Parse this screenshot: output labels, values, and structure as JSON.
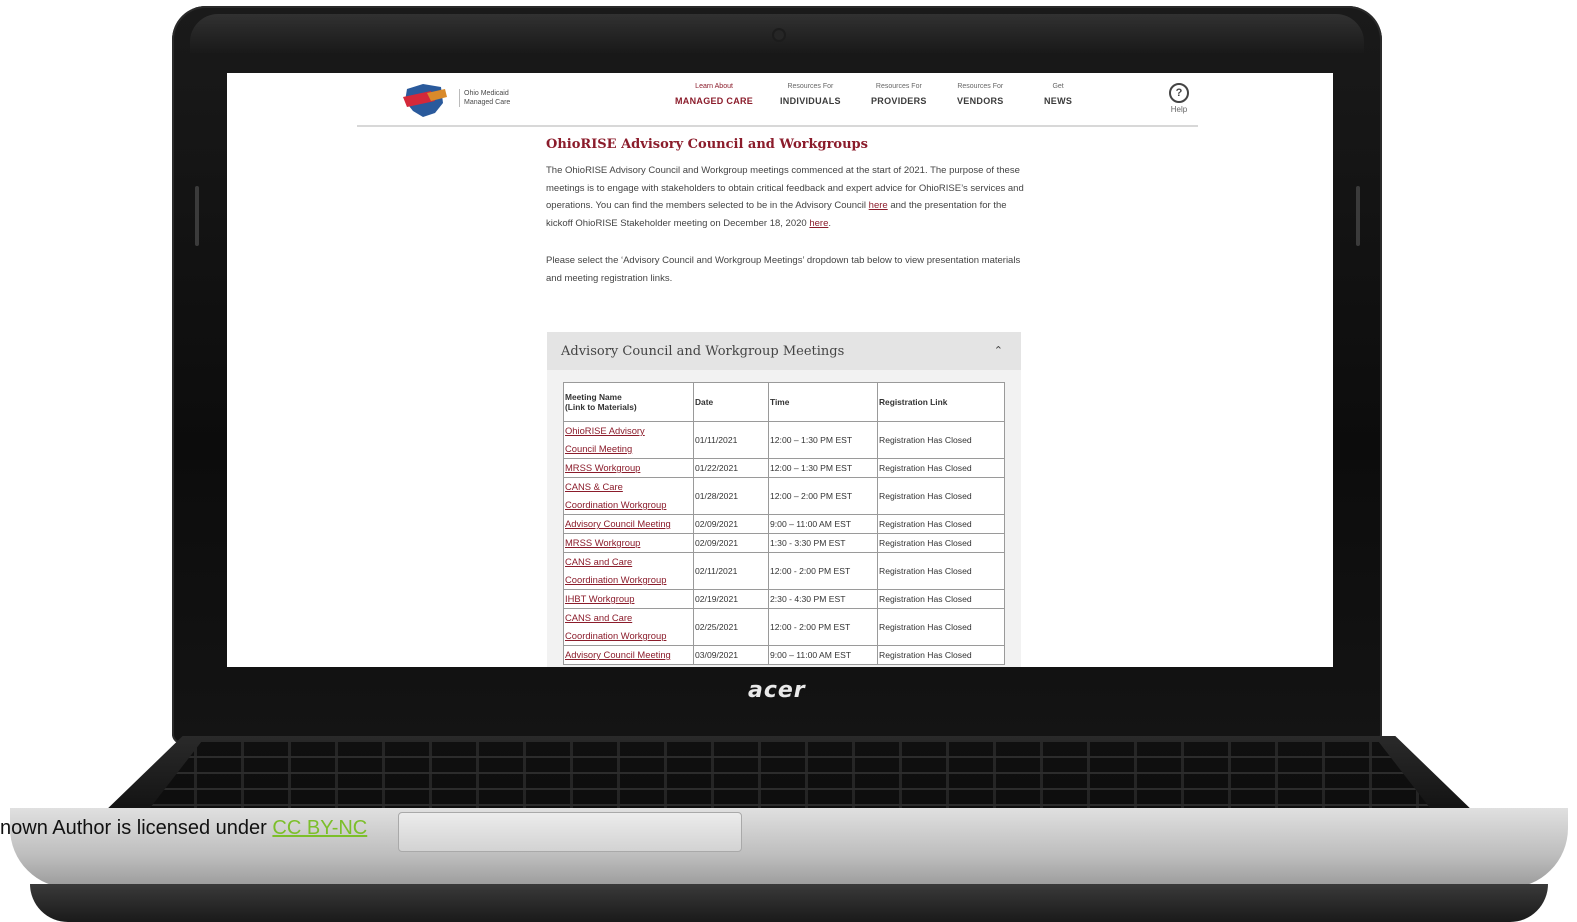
{
  "site": {
    "logo_text": "Ohio Medicaid Managed Care",
    "nav": [
      {
        "small": "Learn About",
        "big": "MANAGED CARE",
        "active": true
      },
      {
        "small": "Resources For",
        "big": "INDIVIDUALS",
        "active": false
      },
      {
        "small": "Resources For",
        "big": "PROVIDERS",
        "active": false
      },
      {
        "small": "Resources For",
        "big": "VENDORS",
        "active": false
      },
      {
        "small": "Get",
        "big": "NEWS",
        "active": false
      }
    ],
    "help_icon": "question-circle-icon",
    "help_label": "Help"
  },
  "page": {
    "title": "OhioRISE Advisory Council and Workgroups",
    "para1_a": "The OhioRISE Advisory Council and Workgroup meetings commenced at the start of 2021. The purpose of these meetings is to engage with stakeholders to obtain critical feedback and expert advice for OhioRISE’s services and operations. You can find the members selected to be in the Advisory Council ",
    "para1_link1": "here",
    "para1_b": " and the presentation for the kickoff OhioRISE Stakeholder meeting on December 18, 2020 ",
    "para1_link2": "here",
    "para1_c": ".",
    "para2": "Please select the ‘Advisory Council and Workgroup Meetings’ dropdown tab below to view presentation materials and meeting registration links."
  },
  "accordion": {
    "title": "Advisory Council and Workgroup Meetings",
    "chevron_icon": "chevron-up-icon",
    "expanded": true
  },
  "table": {
    "headers": {
      "meeting_line1": "Meeting Name",
      "meeting_line2": "(Link to Materials)",
      "date": "Date",
      "time": "Time",
      "registration": "Registration Link"
    },
    "rows": [
      {
        "name1": "OhioRISE Advisory",
        "name2": "Council Meeting",
        "date": "01/11/2021",
        "time": "12:00 – 1:30 PM EST",
        "reg": "Registration Has Closed"
      },
      {
        "name1": "MRSS Workgroup",
        "name2": "",
        "date": "01/22/2021",
        "time": "12:00 – 1:30 PM EST",
        "reg": "Registration Has Closed"
      },
      {
        "name1": "CANS & Care",
        "name2": "Coordination Workgroup",
        "date": "01/28/2021",
        "time": "12:00 – 2:00 PM EST",
        "reg": "Registration Has Closed"
      },
      {
        "name1": "Advisory Council Meeting",
        "name2": "",
        "date": "02/09/2021",
        "time": "9:00 – 11:00 AM EST",
        "reg": "Registration Has Closed"
      },
      {
        "name1": "MRSS Workgroup",
        "name2": "",
        "date": "02/09/2021",
        "time": "1:30 - 3:30 PM EST",
        "reg": "Registration Has Closed"
      },
      {
        "name1": "CANS and Care",
        "name2": "Coordination Workgroup",
        "date": "02/11/2021",
        "time": "12:00 - 2:00 PM EST",
        "reg": "Registration Has Closed"
      },
      {
        "name1": "IHBT Workgroup",
        "name2": "",
        "date": "02/19/2021",
        "time": "2:30 - 4:30 PM EST",
        "reg": "Registration Has Closed"
      },
      {
        "name1": "CANS and Care",
        "name2": "Coordination Workgroup",
        "date": "02/25/2021",
        "time": "12:00 - 2:00 PM EST",
        "reg": "Registration Has Closed"
      },
      {
        "name1": "Advisory Council Meeting",
        "name2": "",
        "date": "03/09/2021",
        "time": "9:00 – 11:00 AM EST",
        "reg": "Registration Has Closed"
      }
    ]
  },
  "laptop": {
    "brand": "acer"
  },
  "credit": {
    "text": "nown Author is licensed under ",
    "link": "CC BY-NC"
  },
  "colors": {
    "accent": "#8b1c2b",
    "credit_link": "#7cbf2a"
  }
}
